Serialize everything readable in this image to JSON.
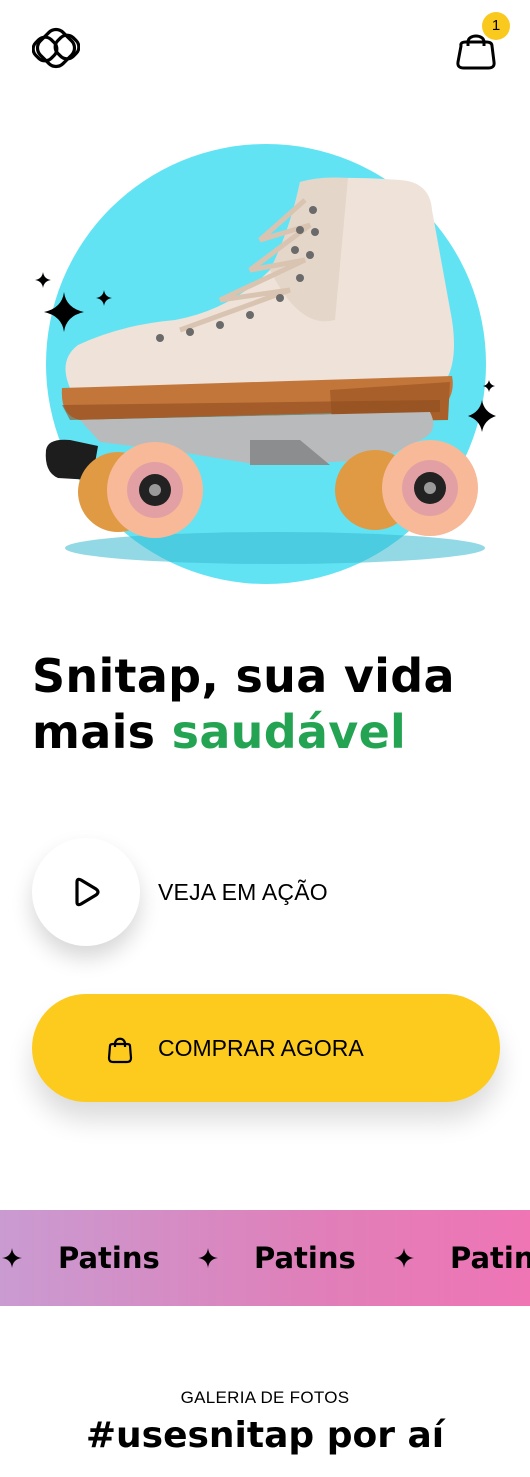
{
  "header": {
    "logo_icon": "snitap-logo-icon",
    "cart_icon": "shopping-bag-icon",
    "cart_count": "1"
  },
  "hero": {
    "image": "roller-skate-product-photo",
    "circle_color": "#61e3f4",
    "decorations": "sparkle-icon"
  },
  "headline": {
    "part1": "Snitap, sua vida",
    "part2": "mais ",
    "accent": "saudável",
    "accent_color": "#24a452"
  },
  "video": {
    "icon": "play-icon",
    "label": "VEJA EM AÇÃO"
  },
  "cta": {
    "icon": "shopping-bag-icon",
    "label": "COMPRAR AGORA",
    "color": "#fccb1e"
  },
  "marquee": {
    "items": [
      "Patins",
      "Patins",
      "Patins"
    ],
    "separator_icon": "four-point-star-icon"
  },
  "gallery": {
    "eyebrow": "GALERIA DE FOTOS",
    "title": "#usesnitap por aí"
  }
}
